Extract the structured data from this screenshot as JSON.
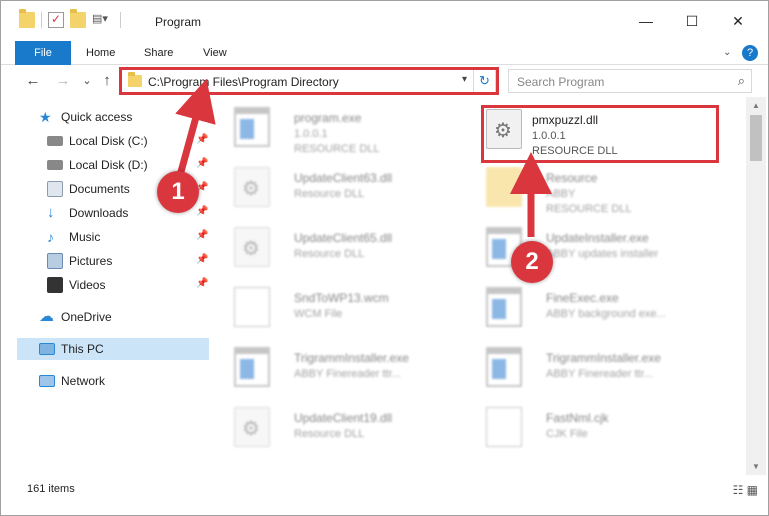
{
  "window": {
    "title": "Program",
    "minimize": "—",
    "maximize": "☐",
    "close": "✕"
  },
  "ribbon": {
    "tabs": [
      "File",
      "Home",
      "Share",
      "View"
    ],
    "help": "?"
  },
  "nav": {
    "back": "←",
    "forward": "→",
    "recent": "⌄",
    "up": "↑",
    "address": "C:\\Program Files\\Program Directory",
    "refresh": "↻",
    "search_placeholder": "Search Program",
    "search_icon": "⌕"
  },
  "sidebar": {
    "items": [
      {
        "label": "Quick access",
        "icon": "star-icon",
        "color": "#2a87d6"
      },
      {
        "label": "Local Disk (C:)",
        "icon": "drive-icon",
        "color": "#777777"
      },
      {
        "label": "Local Disk (D:)",
        "icon": "drive-icon",
        "color": "#777777"
      },
      {
        "label": "Documents",
        "icon": "documents-icon",
        "color": "#8a9bb0"
      },
      {
        "label": "Downloads",
        "icon": "download-icon",
        "color": "#2a87d6"
      },
      {
        "label": "Music",
        "icon": "music-icon",
        "color": "#2a87d6"
      },
      {
        "label": "Pictures",
        "icon": "pictures-icon",
        "color": "#6a8cb0"
      },
      {
        "label": "Videos",
        "icon": "videos-icon",
        "color": "#333333"
      },
      {
        "label": "OneDrive",
        "icon": "cloud-icon",
        "color": "#2a87d6"
      },
      {
        "label": "This PC",
        "icon": "computer-icon",
        "color": "#2a87d6"
      },
      {
        "label": "Network",
        "icon": "network-icon",
        "color": "#2a87d6"
      }
    ],
    "pin": "📌"
  },
  "files": [
    {
      "name": "program.exe",
      "line1": "1.0.0.1",
      "line2": "RESOURCE DLL",
      "icon": "exe"
    },
    {
      "name": "pmxpuzzl.dll",
      "line1": "1.0.0.1",
      "line2": "RESOURCE DLL",
      "icon": "dll"
    },
    {
      "name": "UpdateClient63.dll",
      "line1": "Resource DLL",
      "line2": "",
      "icon": "dll"
    },
    {
      "name": "Resource",
      "line1": "ABBY",
      "line2": "RESOURCE DLL",
      "icon": "folder"
    },
    {
      "name": "UpdateClient65.dll",
      "line1": "Resource DLL",
      "line2": "",
      "icon": "dll"
    },
    {
      "name": "UpdateInstaller.exe",
      "line1": "ABBY updates installer",
      "line2": "",
      "icon": "exe"
    },
    {
      "name": "SndToWP13.wcm",
      "line1": "WCM File",
      "line2": "",
      "icon": "file"
    },
    {
      "name": "FineExec.exe",
      "line1": "ABBY background exe...",
      "line2": "",
      "icon": "exe"
    },
    {
      "name": "TrigrammInstaller.exe",
      "line1": "ABBY Finereader ttr...",
      "line2": "",
      "icon": "exe"
    },
    {
      "name": "TrigrammInstaller.exe",
      "line1": "ABBY Finereader ttr...",
      "line2": "",
      "icon": "exe"
    },
    {
      "name": "UpdateClient19.dll",
      "line1": "Resource DLL",
      "line2": "",
      "icon": "dll"
    },
    {
      "name": "FastNml.cjk",
      "line1": "CJK File",
      "line2": "",
      "icon": "file"
    }
  ],
  "status": {
    "count": "161 items",
    "views": "☷ ▦"
  },
  "annotations": {
    "badge1": "1",
    "badge2": "2",
    "color": "#d9363e"
  }
}
